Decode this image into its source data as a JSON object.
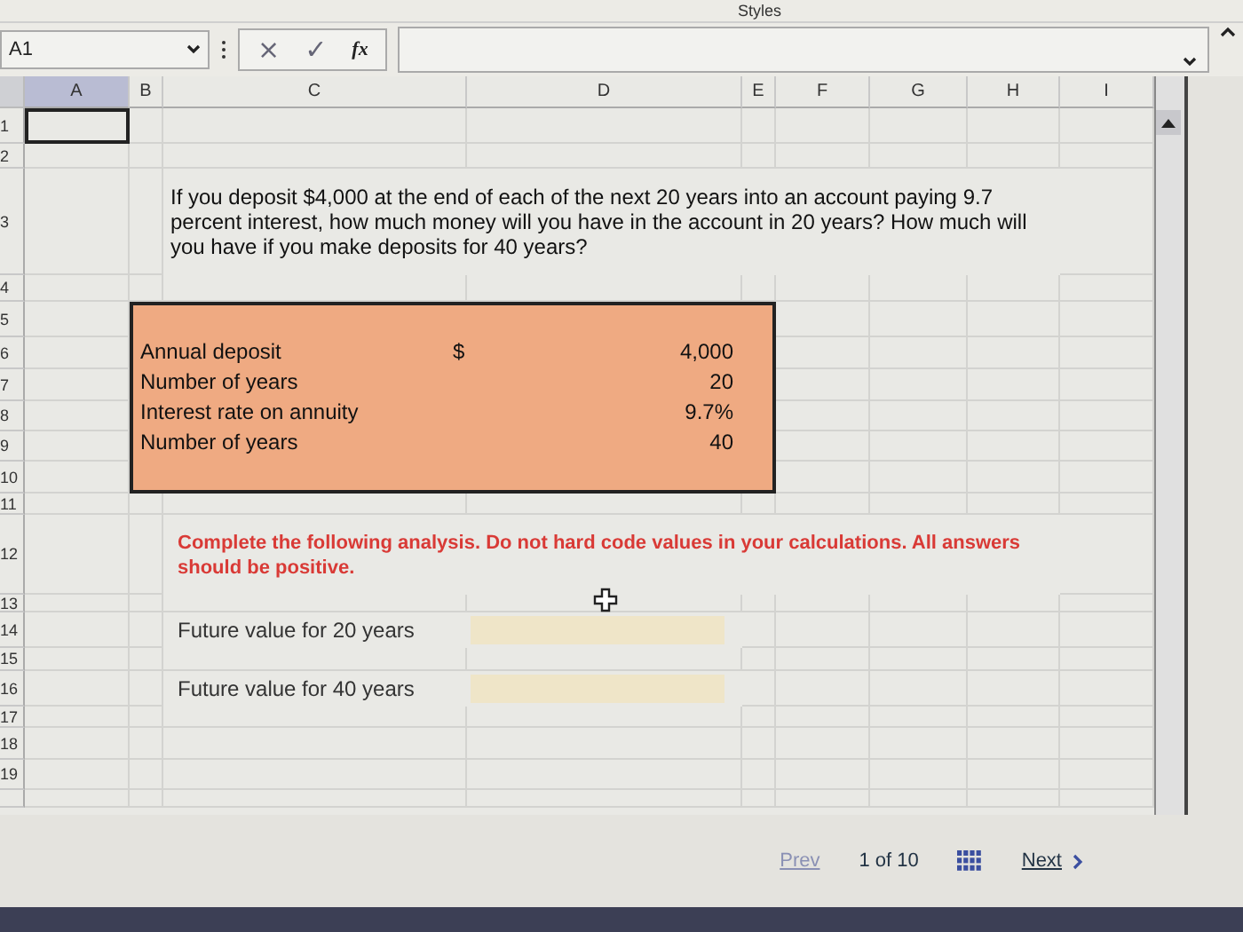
{
  "ribbon": {
    "label": "Styles"
  },
  "formula_bar": {
    "name_box": "A1",
    "cancel": "×",
    "confirm": "✓",
    "function": "fx"
  },
  "columns": [
    {
      "label": "A",
      "selected": true
    },
    {
      "label": "B",
      "selected": false
    },
    {
      "label": "C",
      "selected": false
    },
    {
      "label": "D",
      "selected": false
    },
    {
      "label": "E",
      "selected": false
    },
    {
      "label": "F",
      "selected": false
    },
    {
      "label": "G",
      "selected": false
    },
    {
      "label": "H",
      "selected": false
    },
    {
      "label": "I",
      "selected": false
    }
  ],
  "rows": [
    "1",
    "2",
    "3",
    "4",
    "5",
    "6",
    "7",
    "8",
    "9",
    "10",
    "11",
    "12",
    "13",
    "14",
    "15",
    "16",
    "17",
    "18",
    "19"
  ],
  "question": "If you deposit $4,000 at the end of each of the next 20 years into an account paying 9.7 percent interest, how much money will you have in the account in 20 years? How much will you have if you make deposits for 40 years?",
  "inputs": [
    {
      "label": "Annual deposit",
      "currency": "$",
      "value": "4,000"
    },
    {
      "label": "Number of years",
      "value": "20"
    },
    {
      "label": "Interest rate on annuity",
      "value": "9.7%"
    },
    {
      "label": "Number of years",
      "value": "40"
    }
  ],
  "instruction": "Complete the following analysis. Do not hard code values in your calculations. All answers should be positive.",
  "answers": [
    {
      "label": "Future value for 20 years"
    },
    {
      "label": "Future value for 40 years"
    }
  ],
  "pager": {
    "prev": "Prev",
    "prev_disabled": true,
    "position": "1 of 10",
    "next": "Next"
  }
}
